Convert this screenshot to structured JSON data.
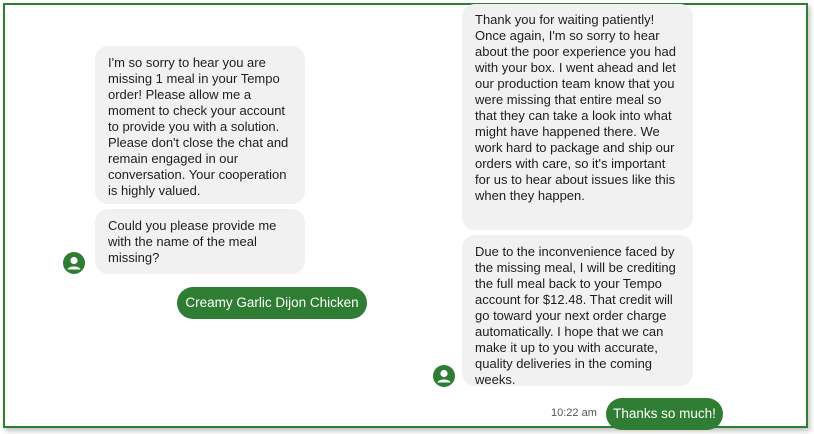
{
  "conversation": {
    "agent_messages_left": [
      "I'm so sorry to hear you are missing 1 meal in your Tempo order! Please allow me a moment to check your account to provide you with a solution. Please don't close the chat and remain engaged in our conversation. Your cooperation is highly valued.",
      "Could you please provide me with the name of the meal missing?"
    ],
    "user_reply_left": "Creamy Garlic Dijon Chicken",
    "agent_messages_right": [
      "Thank you for waiting patiently! Once again, I'm so sorry to hear about the poor experience you had with your box. I went ahead and let our production team know that you were missing that entire meal so that they can take a look into what might have happened there. We work hard to package and ship our orders with care, so it's important for us to hear about issues like this when they happen.",
      "Due to the inconvenience faced by the missing meal, I will be crediting the full meal back to your Tempo account for $12.48. That credit will go toward your next order charge automatically. I hope that we can make it up to you with accurate, quality deliveries in the coming weeks."
    ],
    "user_reply_right": "Thanks so much!",
    "timestamp": "10:22 am"
  },
  "icons": {
    "agent_avatar": "user-avatar-icon"
  },
  "colors": {
    "accent": "#2e7d32",
    "bubble_bg": "#f1f1f1",
    "frame_border": "#2f7d32"
  }
}
